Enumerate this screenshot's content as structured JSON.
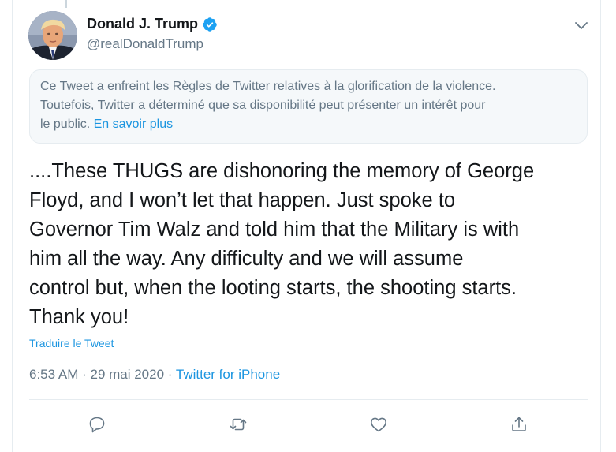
{
  "tweet": {
    "author": {
      "name": "Donald J. Trump",
      "handle": "@realDonaldTrump",
      "verified": true
    },
    "notice": {
      "lines": [
        "Ce Tweet a enfreint les Règles de Twitter relatives à la glorification de la violence.",
        "Toutefois, Twitter a déterminé que sa disponibilité peut présenter un intérêt pour"
      ],
      "line3_prefix": "le public. ",
      "link": "En savoir plus"
    },
    "text_lines": [
      "....These THUGS are dishonoring the memory of George",
      "Floyd, and I won’t let that happen. Just spoke to",
      "Governor Tim Walz and told him that the Military is with",
      "him all the way. Any difficulty and we will assume",
      "control but, when the looting starts, the shooting starts.",
      "Thank you!"
    ],
    "translate_label": "Traduire le Tweet",
    "meta": {
      "time": "6:53 AM",
      "separator": " · ",
      "date": "29 mai 2020",
      "source": "Twitter for iPhone"
    },
    "actions": [
      "reply-icon",
      "retweet-icon",
      "like-icon",
      "share-icon"
    ]
  },
  "colors": {
    "text": "#14171a",
    "secondary": "#657786",
    "link": "#1b95e0",
    "notice_bg": "#f5f8fa",
    "border": "#e6ecf0",
    "verified": "#1da1f2"
  }
}
